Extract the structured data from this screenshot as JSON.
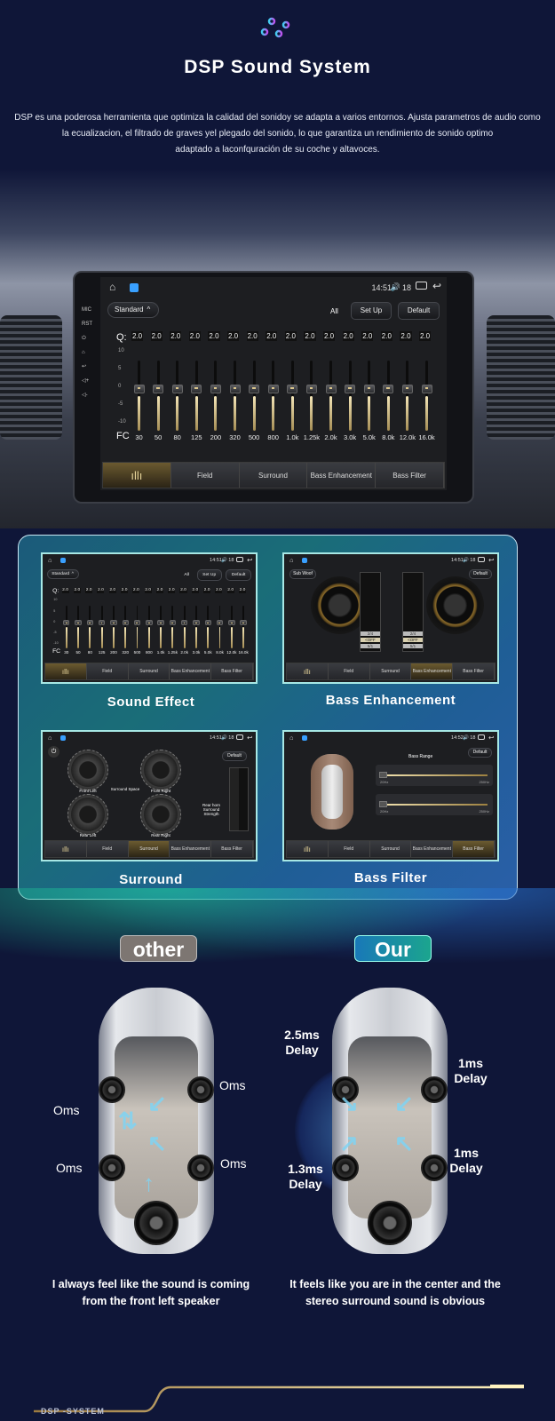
{
  "header": {
    "title": "DSP Sound System",
    "icon": "equalizer-sliders-icon",
    "description": [
      "DSP es una poderosa herramienta que optimiza la calidad del sonidoy se adapta a varios entornos. Ajusta parametros de audio como",
      "la ecualizacion, el filtrado de graves yel plegado del sonido, lo que garantiza un rendimiento de sonido optimo",
      "adaptado a laconfquración de su coche y altavoces."
    ]
  },
  "head_unit": {
    "side_labels": [
      "MIC",
      "RST"
    ],
    "status": {
      "time": "14:51",
      "volume": "18"
    },
    "preset": "Standard",
    "all_label": "All",
    "setup_label": "Set Up",
    "default_label": "Default",
    "q_label": "Q:",
    "fc_label": "FC",
    "q_values": [
      "2.0",
      "2.0",
      "2.0",
      "2.0",
      "2.0",
      "2.0",
      "2.0",
      "2.0",
      "2.0",
      "2.0",
      "2.0",
      "2.0",
      "2.0",
      "2.0",
      "2.0",
      "2.0"
    ],
    "gain_axis": [
      "10",
      "5",
      "0",
      "-5",
      "-10"
    ],
    "gains_db": [
      0,
      0,
      0,
      0,
      0,
      0,
      0,
      0,
      0,
      0,
      0,
      0,
      0,
      0,
      0,
      0
    ],
    "frequencies": [
      "30",
      "50",
      "80",
      "125",
      "200",
      "320",
      "500",
      "800",
      "1.0k",
      "1.25k",
      "2.0k",
      "3.0k",
      "5.0k",
      "8.0k",
      "12.0k",
      "16.0k"
    ],
    "tabs": [
      "",
      "Field",
      "Surround",
      "Bass Enhancement",
      "Bass Filter"
    ]
  },
  "features": [
    {
      "caption": "Sound Effect",
      "time": "14:51",
      "volume": "18",
      "active_tab": 0
    },
    {
      "caption": "Bass Enhancement",
      "time": "14:51",
      "volume": "18",
      "active_tab": 3,
      "subwoof_label": "Sub Woof",
      "default_label": "Default",
      "switch_values": [
        "2/4",
        "<OFF",
        "5/1"
      ]
    },
    {
      "caption": "Surround",
      "time": "14:51",
      "volume": "18",
      "active_tab": 2,
      "default_label": "Default",
      "dials": [
        "Front Left",
        "Front Right",
        "Rear Left",
        "Rear Right"
      ],
      "center_label": "Surround Space",
      "strength_label": "Rear horn Surround Strength"
    },
    {
      "caption": "Bass Filter",
      "time": "14:52",
      "volume": "18",
      "active_tab": 4,
      "default_label": "Default",
      "range_label": "Bass Range",
      "range_min": "20Hz",
      "range_max": "250Hz"
    }
  ],
  "comparison": {
    "other": {
      "badge": "other",
      "labels": [
        "Oms",
        "Oms",
        "Oms",
        "Oms"
      ],
      "caption": [
        "I always feel like the sound is coming",
        "from the front left speaker"
      ]
    },
    "our": {
      "badge": "Our",
      "labels": [
        "2.5ms Delay",
        "1ms Delay",
        "1.3ms Delay",
        "1ms Delay"
      ],
      "caption": [
        "It feels like you are in the center and the",
        "stereo surround sound is obvious"
      ]
    }
  },
  "footer": {
    "brand": "DSP -SYSTEM"
  },
  "colors": {
    "background": "#0f1638",
    "gold": "#d9c07c",
    "other_badge": "#7d7672",
    "our_badge": "#1a8fb5"
  }
}
